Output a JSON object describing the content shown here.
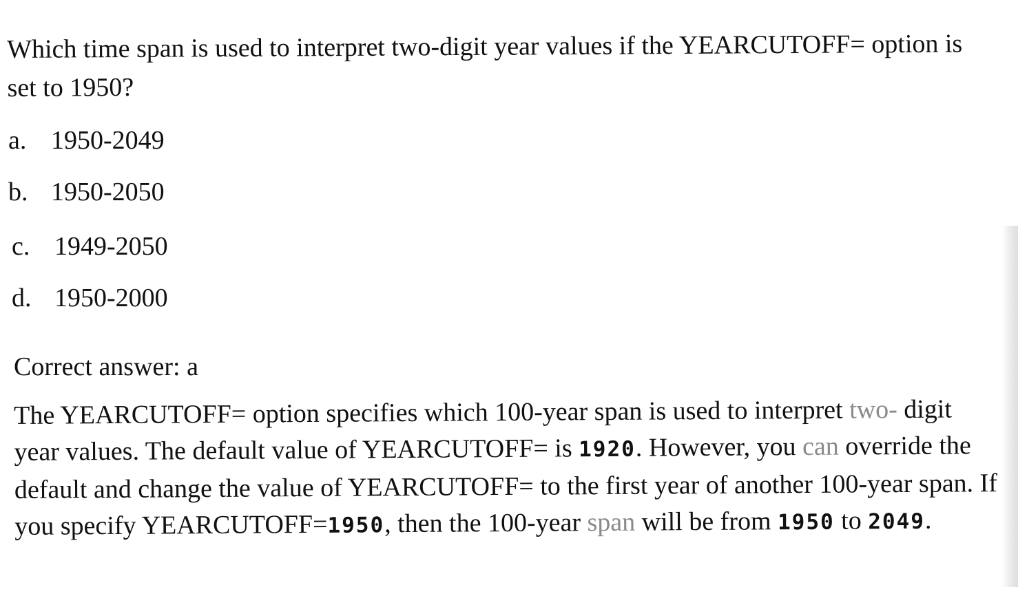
{
  "question": {
    "text": "Which time span is used to interpret two-digit year values if the YEARCUTOFF= option is set to 1950?"
  },
  "options": [
    {
      "letter": "a.",
      "text": "1950-2049"
    },
    {
      "letter": "b.",
      "text": "1950-2050"
    },
    {
      "letter": "c.",
      "text": "1949-2050"
    },
    {
      "letter": "d.",
      "text": "1950-2000"
    }
  ],
  "answer": {
    "text": "Correct answer: a"
  },
  "explanation": {
    "p1": "The YEARCUTOFF= option specifies which 100-year span is used to interpret ",
    "p1_faded": "two-",
    "p2": " digit year values. The default value of YEARCUTOFF= is ",
    "code_default": "1920",
    "p3": ". However, you ",
    "p3_faded": "can",
    "p4": " override the default and change the value of YEARCUTOFF= to the first year of another 100-year span. If you specify YEARCUTOFF=",
    "code_specify": "1950",
    "p5": ", then the 100-year ",
    "p5_faded": "span",
    "p6": " will be from ",
    "code_start": "1950",
    "p7": " to ",
    "code_end": "2049",
    "p8": "."
  }
}
